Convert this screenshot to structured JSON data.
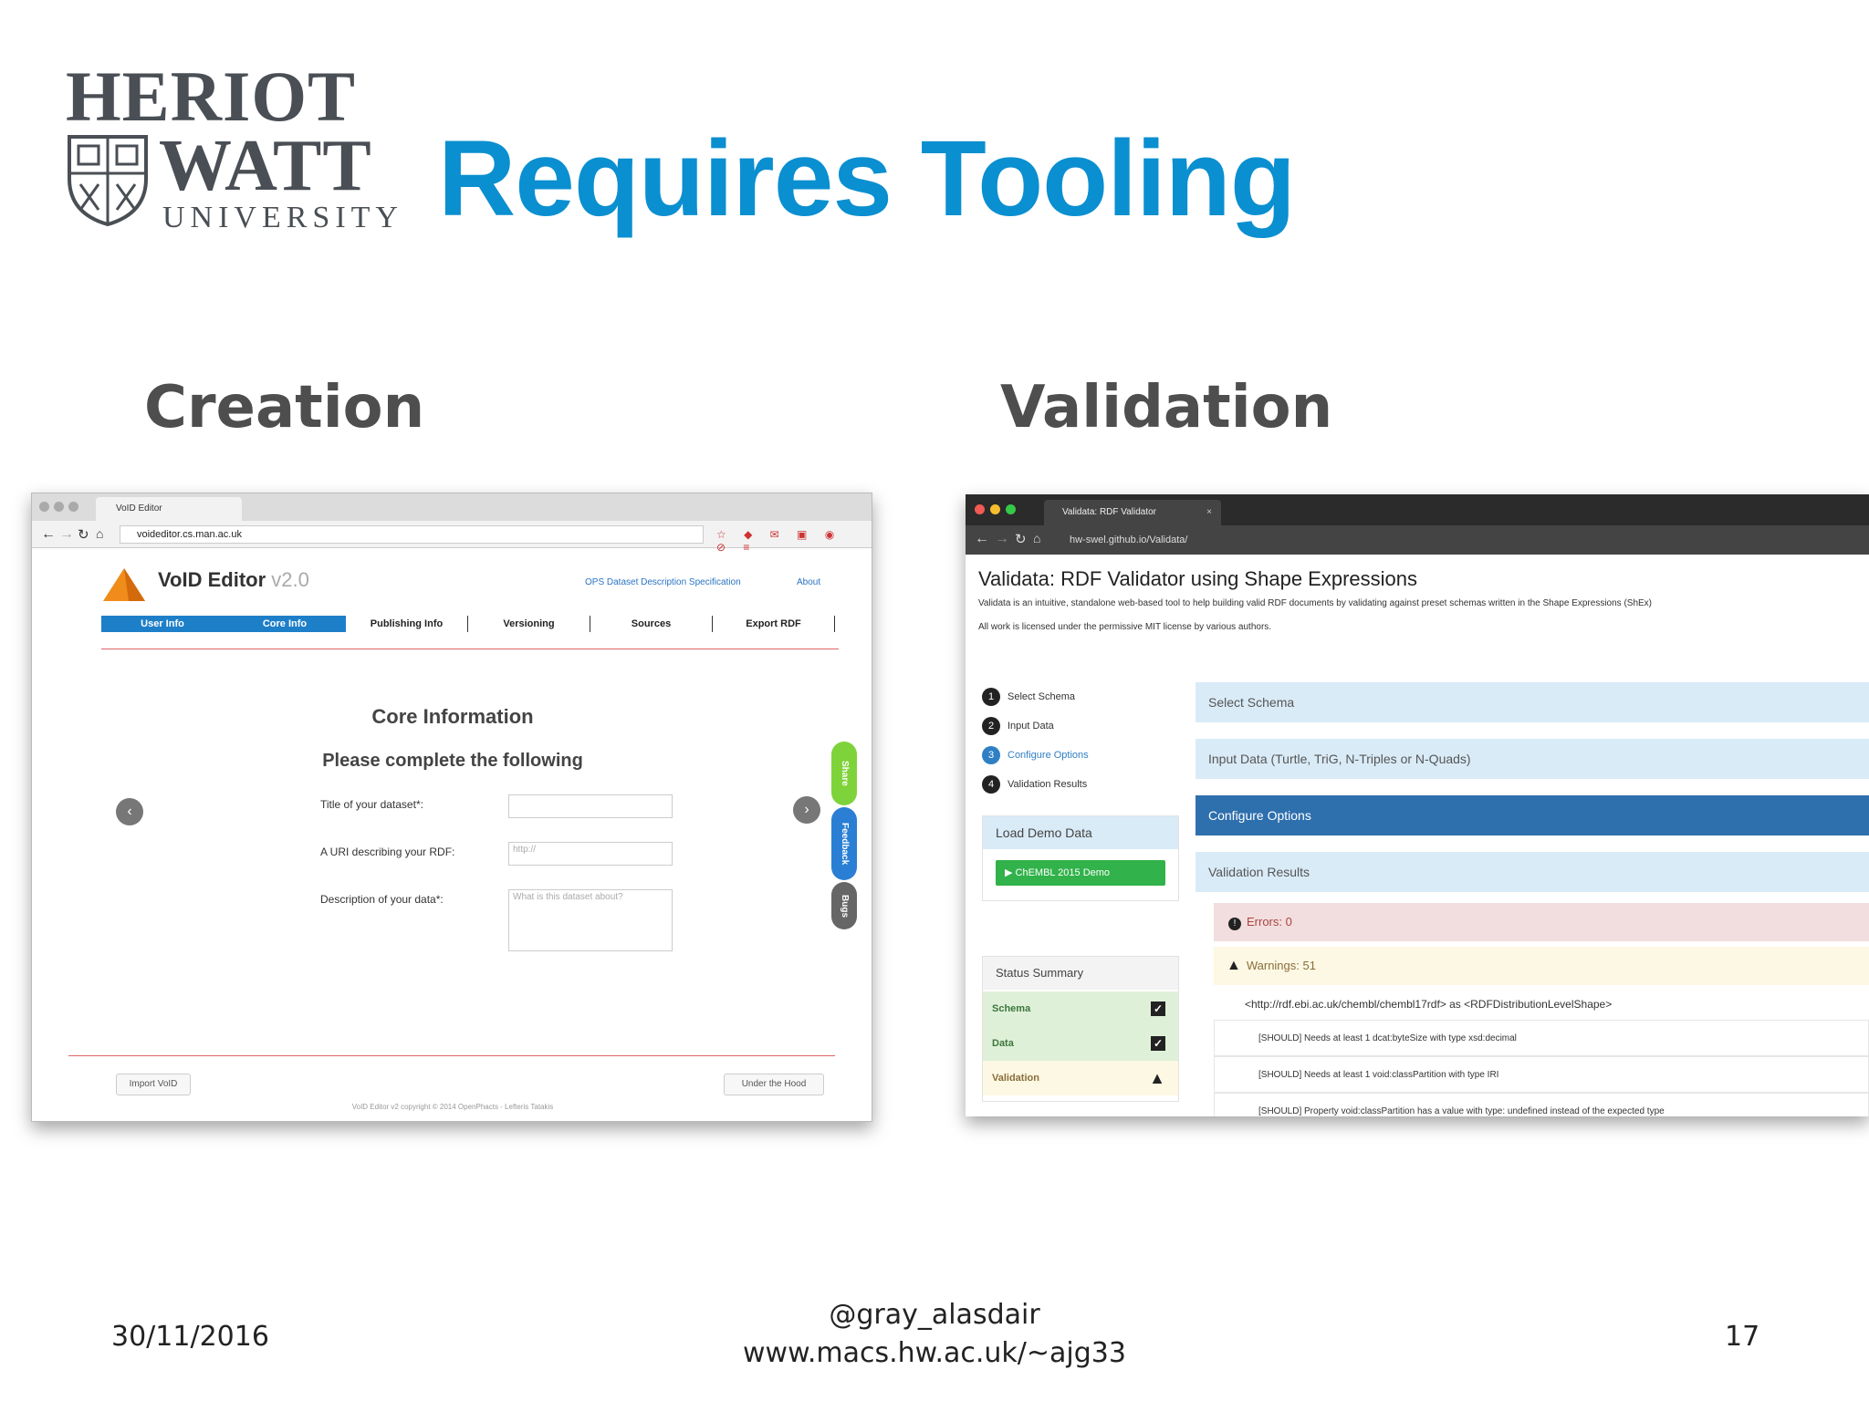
{
  "logo": {
    "line1": "HERIOT",
    "line2": "WATT",
    "line3": "UNIVERSITY"
  },
  "title": "Requires Tooling",
  "left": {
    "heading": "Creation",
    "browser": {
      "tab_title": "VoID Editor",
      "url": "voideditor.cs.man.ac.uk"
    },
    "app": {
      "name": "VoID Editor",
      "version": "v2.0",
      "top_links": [
        "OPS Dataset Description Specification",
        "About"
      ],
      "tabs": [
        "User Info",
        "Core Info",
        "Publishing Info",
        "Versioning",
        "Sources",
        "Export RDF"
      ],
      "section_title": "Core Information",
      "instruction": "Please complete the following",
      "fields": [
        {
          "label": "Title of your dataset*:",
          "placeholder": ""
        },
        {
          "label": "A URI describing your RDF:",
          "placeholder": "http://"
        },
        {
          "label": "Description of your data*:",
          "placeholder": "What is this dataset about?"
        }
      ],
      "side_buttons": [
        "Share",
        "Feedback",
        "Bugs"
      ],
      "import_button": "Import VoID",
      "hood_button": "Under the Hood",
      "copyright": "VoID Editor v2 copyright © 2014 OpenPhacts - Lefteris Tatakis"
    }
  },
  "right": {
    "heading": "Validation",
    "browser": {
      "tab_title": "Validata: RDF Validator",
      "url": "hw-swel.github.io/Validata/"
    },
    "app": {
      "title": "Validata: RDF Validator using Shape Expressions",
      "desc1": "Validata is an intuitive, standalone web-based tool to help building valid RDF documents by validating against preset schemas written in the Shape Expressions (ShEx)",
      "desc2": "All work is licensed under the permissive MIT license by various authors.",
      "steps": [
        {
          "num": "1",
          "label": "Select Schema"
        },
        {
          "num": "2",
          "label": "Input Data"
        },
        {
          "num": "3",
          "label": "Configure Options"
        },
        {
          "num": "4",
          "label": "Validation Results"
        }
      ],
      "load_demo": "Load Demo Data",
      "demo_button": "▶ ChEMBL 2015 Demo",
      "status_summary": "Status Summary",
      "status_rows": [
        "Schema",
        "Data",
        "Validation"
      ],
      "panels": [
        "Select Schema",
        "Input Data (Turtle, TriG, N-Triples or N-Quads)",
        "Configure Options",
        "Validation Results"
      ],
      "errors": "Errors: 0",
      "warnings": "Warnings: 51",
      "result_head": "<http://rdf.ebi.ac.uk/chembl/chembl17rdf> as <RDFDistributionLevelShape>",
      "result_lines": [
        "[SHOULD] Needs at least 1 dcat:byteSize with type xsd:decimal",
        "[SHOULD] Needs at least 1 void:classPartition with type IRI",
        "[SHOULD] Property void:classPartition has a value with type: undefined instead of the expected type"
      ]
    }
  },
  "footer": {
    "date": "30/11/2016",
    "handle": "@gray_alasdair",
    "url": "www.macs.hw.ac.uk/~ajg33",
    "page": "17"
  }
}
